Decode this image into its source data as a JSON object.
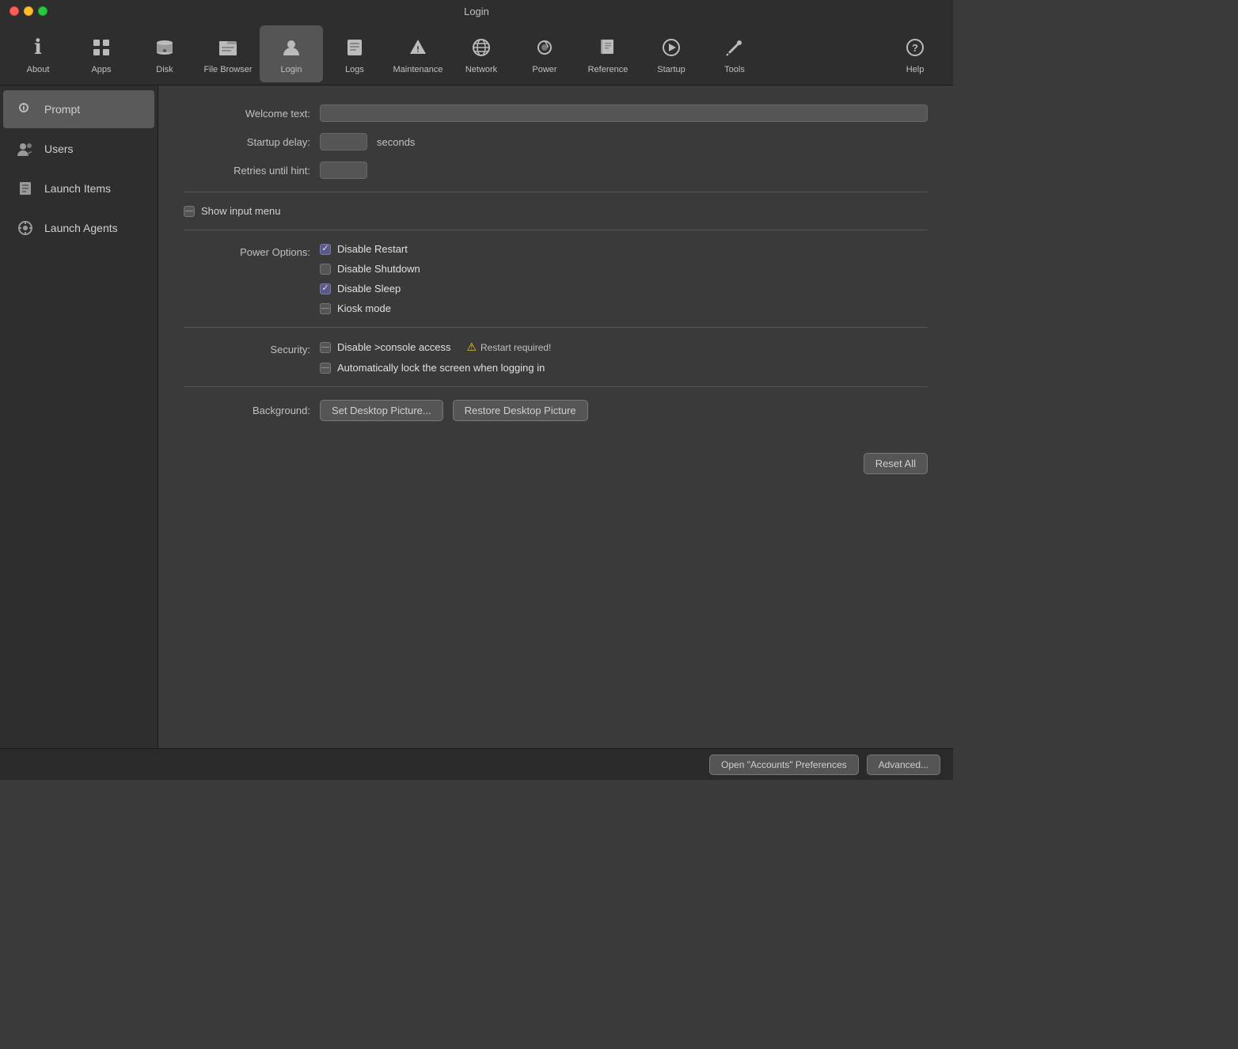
{
  "window": {
    "title": "Login"
  },
  "toolbar": {
    "items": [
      {
        "id": "about",
        "label": "About",
        "icon": "ℹ"
      },
      {
        "id": "apps",
        "label": "Apps",
        "icon": "⊞"
      },
      {
        "id": "disk",
        "label": "Disk",
        "icon": "💾"
      },
      {
        "id": "file-browser",
        "label": "File Browser",
        "icon": "📁"
      },
      {
        "id": "login",
        "label": "Login",
        "icon": "👤"
      },
      {
        "id": "logs",
        "label": "Logs",
        "icon": "📋"
      },
      {
        "id": "maintenance",
        "label": "Maintenance",
        "icon": "🔽"
      },
      {
        "id": "network",
        "label": "Network",
        "icon": "🌐"
      },
      {
        "id": "power",
        "label": "Power",
        "icon": "💡"
      },
      {
        "id": "reference",
        "label": "Reference",
        "icon": "📖"
      },
      {
        "id": "startup",
        "label": "Startup",
        "icon": "▶"
      },
      {
        "id": "tools",
        "label": "Tools",
        "icon": "🔧"
      },
      {
        "id": "help",
        "label": "Help",
        "icon": "?"
      }
    ]
  },
  "sidebar": {
    "items": [
      {
        "id": "prompt",
        "label": "Prompt",
        "icon": "🔑"
      },
      {
        "id": "users",
        "label": "Users",
        "icon": "👥"
      },
      {
        "id": "launch-items",
        "label": "Launch Items",
        "icon": "📄"
      },
      {
        "id": "launch-agents",
        "label": "Launch Agents",
        "icon": "⚙"
      }
    ]
  },
  "content": {
    "welcome_text_label": "Welcome text:",
    "welcome_text_value": "",
    "startup_delay_label": "Startup delay:",
    "startup_delay_value": "",
    "seconds_label": "seconds",
    "retries_hint_label": "Retries until hint:",
    "retries_hint_value": "",
    "show_input_menu_label": "Show input menu",
    "power_options_label": "Power Options:",
    "disable_restart_label": "Disable Restart",
    "disable_restart_checked": true,
    "disable_shutdown_label": "Disable Shutdown",
    "disable_shutdown_checked": false,
    "disable_sleep_label": "Disable Sleep",
    "disable_sleep_checked": true,
    "kiosk_mode_label": "Kiosk mode",
    "kiosk_mode_indeterminate": true,
    "security_label": "Security:",
    "disable_console_label": "Disable >console access",
    "disable_console_indeterminate": true,
    "restart_required_label": "Restart required!",
    "auto_lock_label": "Automatically lock the screen when logging in",
    "auto_lock_indeterminate": true,
    "background_label": "Background:",
    "set_desktop_picture_btn": "Set Desktop Picture...",
    "restore_desktop_picture_btn": "Restore Desktop Picture",
    "reset_all_btn": "Reset All",
    "open_accounts_btn": "Open \"Accounts\" Preferences",
    "advanced_btn": "Advanced..."
  }
}
